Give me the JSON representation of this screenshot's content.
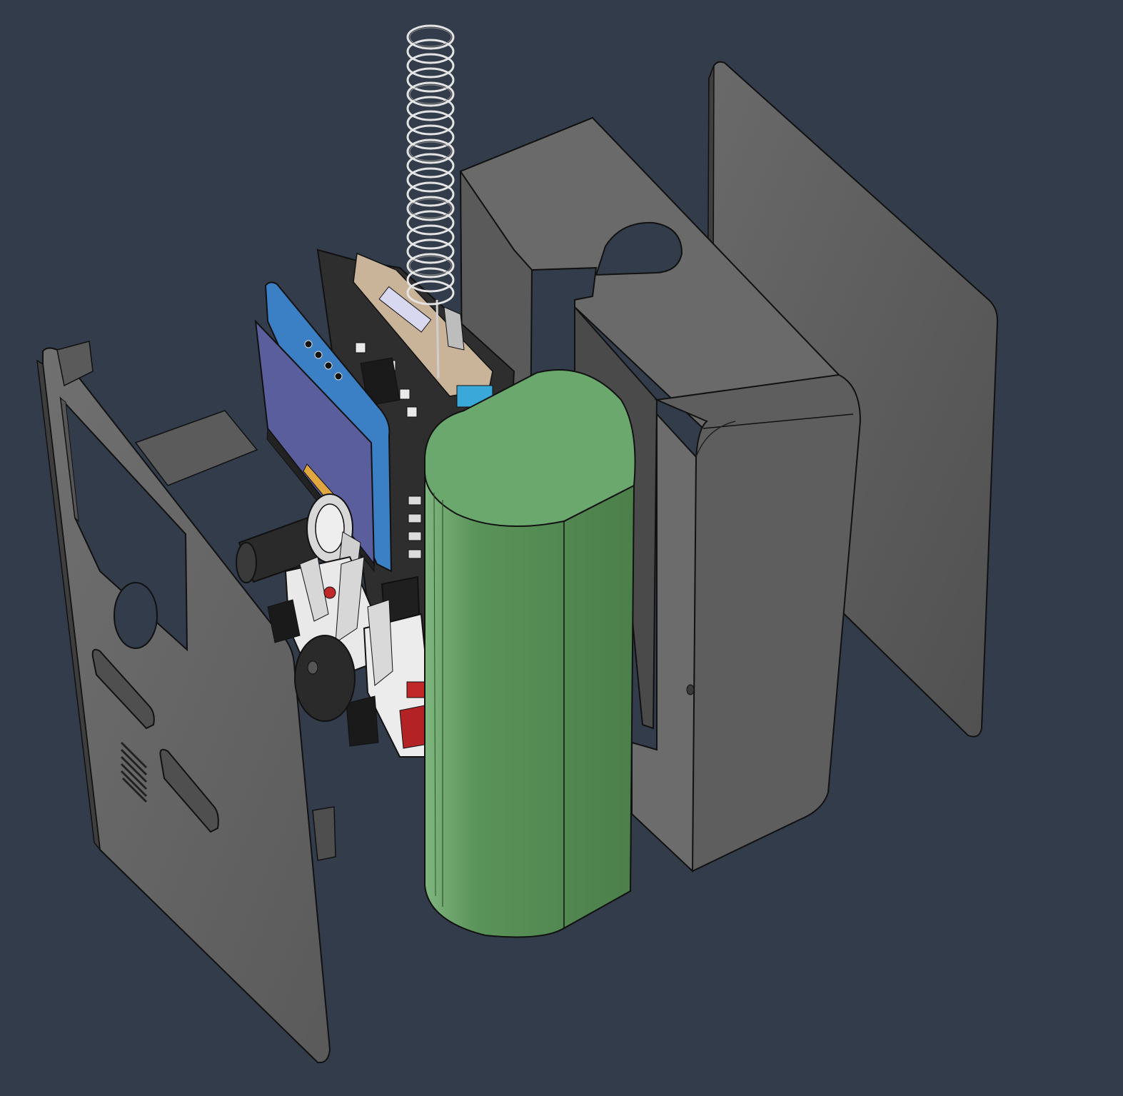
{
  "scene": {
    "background": "#333c4a",
    "colors": {
      "shell_light": "#707070",
      "shell_mid": "#5e5e5e",
      "shell_dark": "#4e4e4e",
      "edge": "#111111",
      "battery_top": "#6aa86e",
      "battery_side": "#52874f",
      "pcb_black": "#2b2b2b",
      "pcb_tan": "#c9b49a",
      "oled_pcb": "#3b7fc4",
      "oled_glass": "#5a5e9c",
      "antenna": "#e4e4e4",
      "button_red": "#c0282a",
      "switch_white": "#e9e9e9"
    },
    "icons": [
      "spring-antenna-icon",
      "rotary-encoder-icon",
      "buzzer-icon",
      "speaker-grille-icon"
    ]
  }
}
